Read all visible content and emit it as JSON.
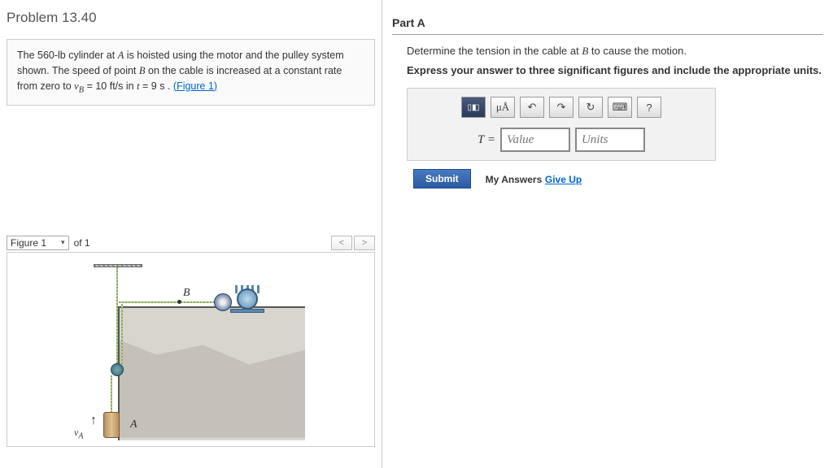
{
  "problem": {
    "title": "Problem 13.40",
    "text_prefix": "The 560-",
    "lb": "lb",
    "text_1": " cylinder at ",
    "A": "A",
    "text_2": " is hoisted using the motor and the pulley system shown. The speed of point ",
    "B": "B",
    "text_3": " on the cable is increased at a constant rate from zero to ",
    "vb_var": "v",
    "vb_sub": "B",
    "text_4": " = 10  ",
    "units1": "ft/s",
    "text_5": " in ",
    "t_var": "t",
    "text_6": " = 9   ",
    "units2": "s",
    "text_7": " . ",
    "figlink": "(Figure 1)"
  },
  "figurebar": {
    "select": "Figure 1",
    "of": "of 1"
  },
  "diagram": {
    "B": "B",
    "A": "A",
    "vA": "v",
    "vA_sub": "A",
    "arrow": "↑"
  },
  "partA": {
    "title": "Part A",
    "instr_1": "Determine the tension in the cable at ",
    "B": "B",
    "instr_2": " to cause the motion.",
    "bold": "Express your answer to three significant figures and include the appropriate units."
  },
  "toolbar": {
    "micro": "μÅ",
    "undo": "↶",
    "redo": "↷",
    "reset": "↻",
    "kbd": "⌨",
    "help": "?"
  },
  "answer": {
    "label": "T = ",
    "value_ph": "Value",
    "units_ph": "Units"
  },
  "submit": {
    "btn": "Submit",
    "my": "My Answers",
    "giveup": "Give Up"
  }
}
